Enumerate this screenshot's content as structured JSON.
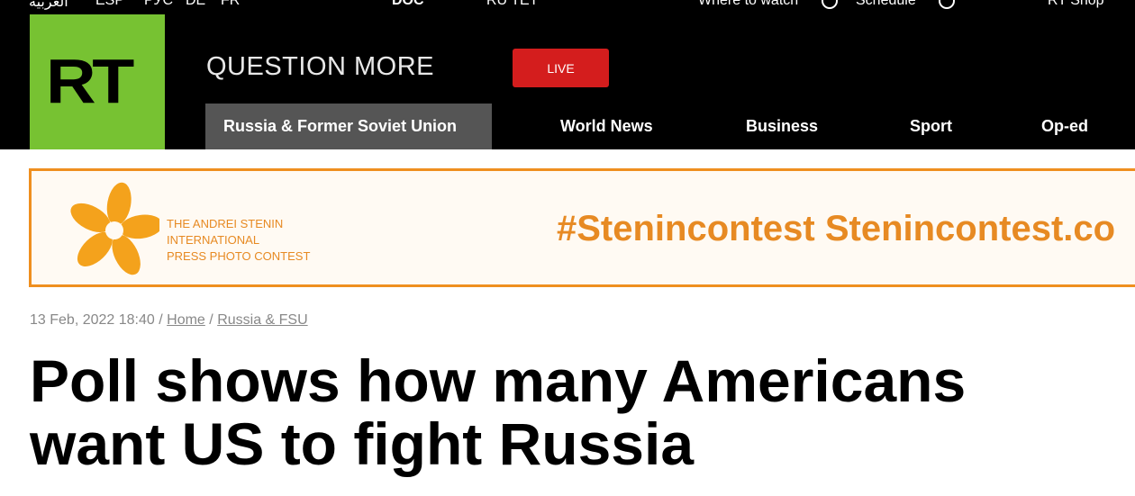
{
  "topbar": {
    "lang_ar": "العربية",
    "lang_esp": "ESP",
    "lang_rus": "РУС",
    "lang_de": "DE",
    "lang_fr": "FR",
    "doc_label": "DOC",
    "rutv_label": "RU TET",
    "where_to_watch": "Where to watch",
    "schedule": "Schedule",
    "shop": "RT Shop"
  },
  "header": {
    "logo": "RT",
    "tagline": "QUESTION MORE",
    "live": "LIVE",
    "nav": [
      {
        "label": "Russia & Former Soviet Union"
      },
      {
        "label": "World News"
      },
      {
        "label": "Business"
      },
      {
        "label": "Sport"
      },
      {
        "label": "Op-ed"
      }
    ]
  },
  "banner": {
    "line1": "THE ANDREI STENIN",
    "line2": "INTERNATIONAL",
    "line3": "PRESS PHOTO CONTEST",
    "hashtag": "#Stenincontest   Stenincontest.co"
  },
  "article": {
    "date": "13 Feb, 2022 18:40",
    "sep": "/",
    "crumb_home": "Home",
    "crumb_section": "Russia & FSU",
    "headline": "Poll shows how many Americans want US to fight Russia"
  }
}
